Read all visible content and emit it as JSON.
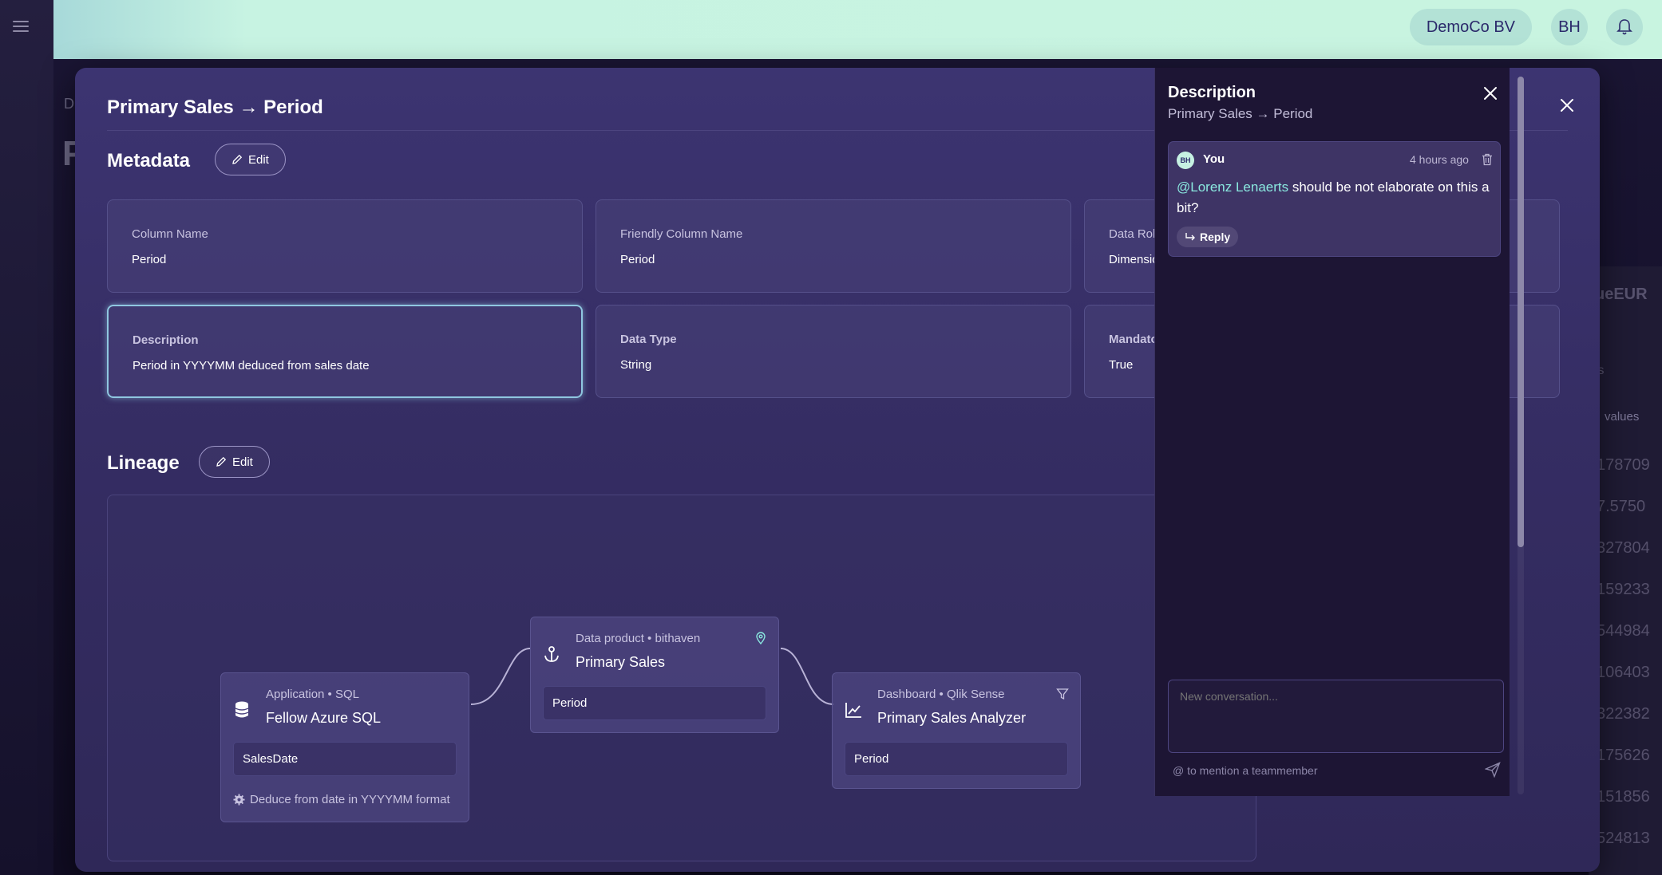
{
  "topbar": {
    "org_label": "DemoCo BV",
    "user_initials": "BH"
  },
  "background": {
    "breadcrumb": "D",
    "title": "P",
    "right_col_header": "ueEUR",
    "right_col_sub": "ls",
    "right_col_values_label": "values",
    "values": [
      "178709",
      "7.5750",
      "327804",
      "159233",
      "544984",
      "106403",
      "322382",
      "175626",
      "151856",
      "524813"
    ]
  },
  "modal": {
    "title": "Primary Sales → Period",
    "metadata": {
      "heading": "Metadata",
      "edit_label": "Edit",
      "cards": [
        {
          "label": "Column Name",
          "value": "Period"
        },
        {
          "label": "Friendly Column Name",
          "value": "Period"
        },
        {
          "label": "Data Role",
          "value": "Dimension"
        },
        {
          "label": "Description",
          "value": "Period in YYYYMM deduced from sales date"
        },
        {
          "label": "Data Type",
          "value": "String"
        },
        {
          "label": "Mandatory",
          "value": "True"
        }
      ]
    },
    "lineage": {
      "heading": "Lineage",
      "edit_label": "Edit",
      "nodes": [
        {
          "meta": "Application • SQL",
          "name": "Fellow Azure SQL",
          "field": "SalesDate",
          "note": "Deduce from date in YYYYMM format",
          "icon": "database-icon"
        },
        {
          "meta": "Data product • bithaven",
          "name": "Primary Sales",
          "field": "Period",
          "icon": "anchor-icon",
          "corner_icon": "map-pin-icon"
        },
        {
          "meta": "Dashboard • Qlik Sense",
          "name": "Primary Sales Analyzer",
          "field": "Period",
          "icon": "chart-line-icon",
          "corner_icon": "filter-icon"
        }
      ]
    }
  },
  "panel": {
    "title": "Description",
    "subtitle": "Primary Sales → Period",
    "comment": {
      "avatar": "BH",
      "author": "You",
      "time": "4 hours ago",
      "mention": "@Lorenz Lenaerts",
      "text": " should be not elaborate on this a bit?",
      "reply_label": "Reply"
    },
    "new_conversation_placeholder": "New conversation...",
    "mention_hint": "@ to mention a teammember"
  },
  "colors": {
    "accent_mint": "#c8f4e0",
    "modal_bg": "#3c3471",
    "highlight_border": "#8fc7e0",
    "mention": "#8ae8df"
  }
}
